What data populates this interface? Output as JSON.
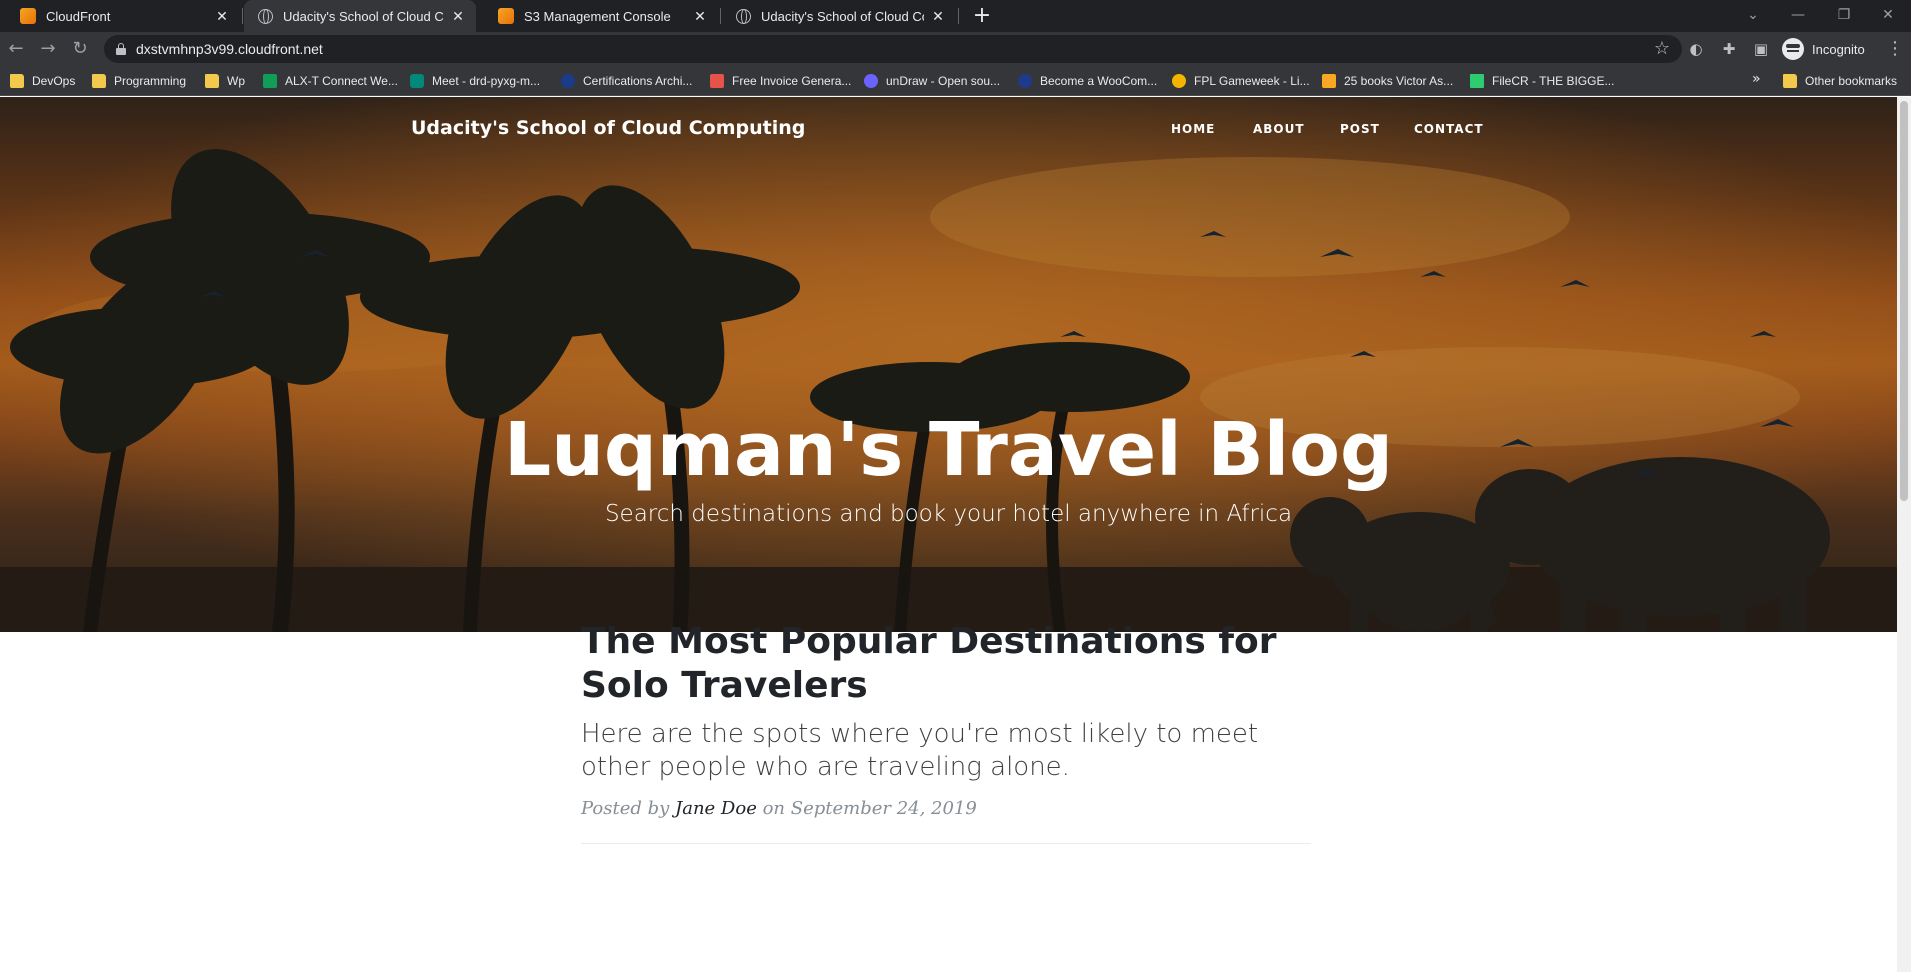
{
  "browser": {
    "tabs": [
      {
        "title": "CloudFront",
        "favicon": "aws-icon",
        "active": false
      },
      {
        "title": "Udacity's School of Cloud Computing",
        "favicon": "globe-icon",
        "active": true
      },
      {
        "title": "S3 Management Console",
        "favicon": "aws-icon",
        "active": false
      },
      {
        "title": "Udacity's School of Cloud Computing",
        "favicon": "globe-icon",
        "active": false
      }
    ],
    "address": "dxstvmhnp3v99.cloudfront.net",
    "profile_label": "Incognito",
    "bookmarks": [
      {
        "label": "DevOps",
        "icon": "folder-icon"
      },
      {
        "label": "Programming",
        "icon": "folder-icon"
      },
      {
        "label": "Wp",
        "icon": "folder-icon"
      },
      {
        "label": "ALX-T Connect We...",
        "icon": "sheets-icon"
      },
      {
        "label": "Meet - drd-pyxg-m...",
        "icon": "meet-icon"
      },
      {
        "label": "Certifications Archi...",
        "icon": "badge-icon"
      },
      {
        "label": "Free Invoice Genera...",
        "icon": "invoice-icon"
      },
      {
        "label": "unDraw - Open sou...",
        "icon": "undraw-icon"
      },
      {
        "label": "Become a WooCom...",
        "icon": "woo-icon"
      },
      {
        "label": "FPL Gameweek - Li...",
        "icon": "fpl-icon"
      },
      {
        "label": "25 books Victor As...",
        "icon": "book-icon"
      },
      {
        "label": "FileCR - THE BIGGE...",
        "icon": "filecr-icon"
      }
    ],
    "overflow": "»",
    "other_bookmarks": "Other bookmarks"
  },
  "site": {
    "brand": "Udacity's School of Cloud Computing",
    "nav": [
      "HOME",
      "ABOUT",
      "POST",
      "CONTACT"
    ],
    "hero_title": "Luqman's Travel Blog",
    "hero_subtitle": "Search destinations and book your hotel anywhere in Africa"
  },
  "post": {
    "title": "The Most Popular Destinations for Solo Travelers",
    "subtitle": "Here are the spots where you're most likely to meet other people who are traveling alone.",
    "meta_prefix": "Posted by",
    "author": "Jane Doe",
    "meta_date": "on September 24, 2019"
  },
  "colors": {
    "chrome_dark": "#202124",
    "chrome_toolbar": "#35363a",
    "sunset_orange": "#c86f22",
    "text_dark": "#212529",
    "meta_gray": "#868e96"
  }
}
